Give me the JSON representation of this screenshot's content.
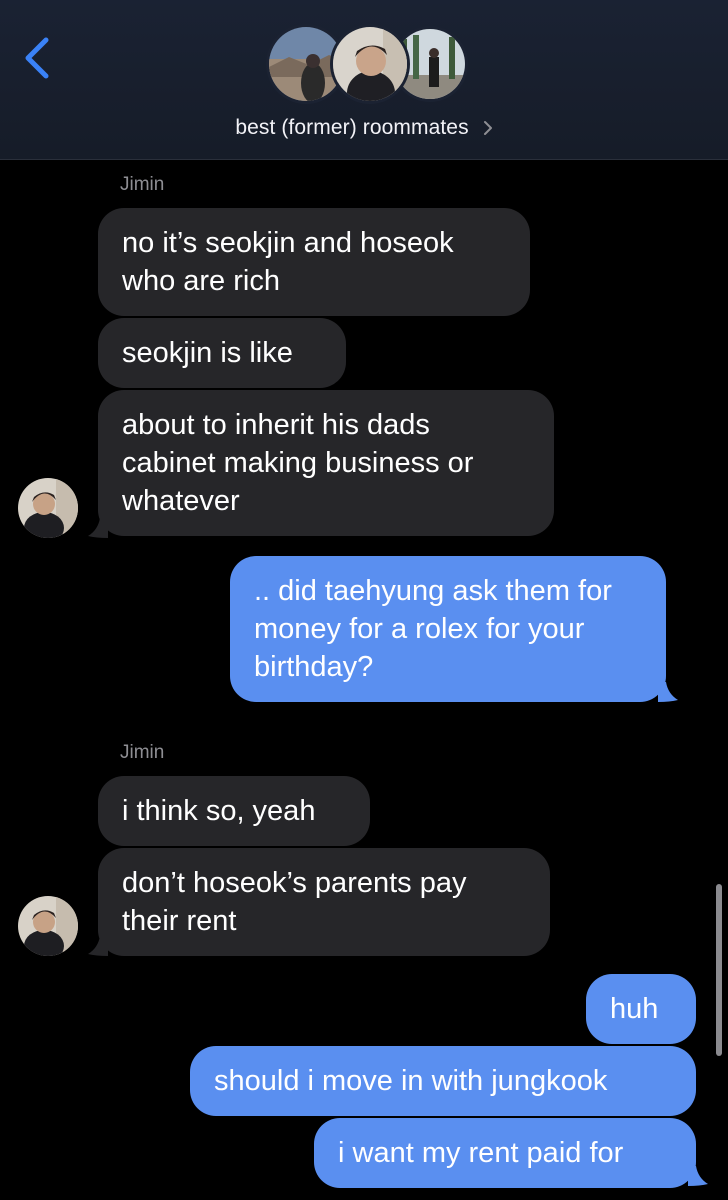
{
  "header": {
    "group_name": "best (former) roommates",
    "back_icon": "chevron-left-icon",
    "title_chevron_icon": "chevron-right-icon",
    "accent_color": "#3a82f7"
  },
  "messages": [
    {
      "sender": "Jimin"
    },
    {
      "text_lines": [
        "no it’s seokjin and hoseok",
        "who are rich"
      ]
    },
    {
      "text_lines": [
        "seokjin is like"
      ]
    },
    {
      "text_lines": [
        "about to inherit his dads",
        "cabinet making business or",
        "whatever"
      ]
    },
    {
      "text_lines": [
        ".. did taehyung ask them for",
        "money for a rolex for your",
        "birthday?"
      ]
    },
    {
      "sender": "Jimin"
    },
    {
      "text_lines": [
        "i think so, yeah"
      ]
    },
    {
      "text_lines": [
        "don’t hoseok’s parents pay",
        "their rent"
      ]
    },
    {
      "text_lines": [
        "huh"
      ]
    },
    {
      "text_lines": [
        "should i move in with jungkook"
      ]
    },
    {
      "text_lines": [
        "i want my rent paid for"
      ]
    }
  ],
  "colors": {
    "incoming_bubble": "#262629",
    "outgoing_bubble": "#5a8ff0",
    "sender_label": "#8e8e93"
  }
}
